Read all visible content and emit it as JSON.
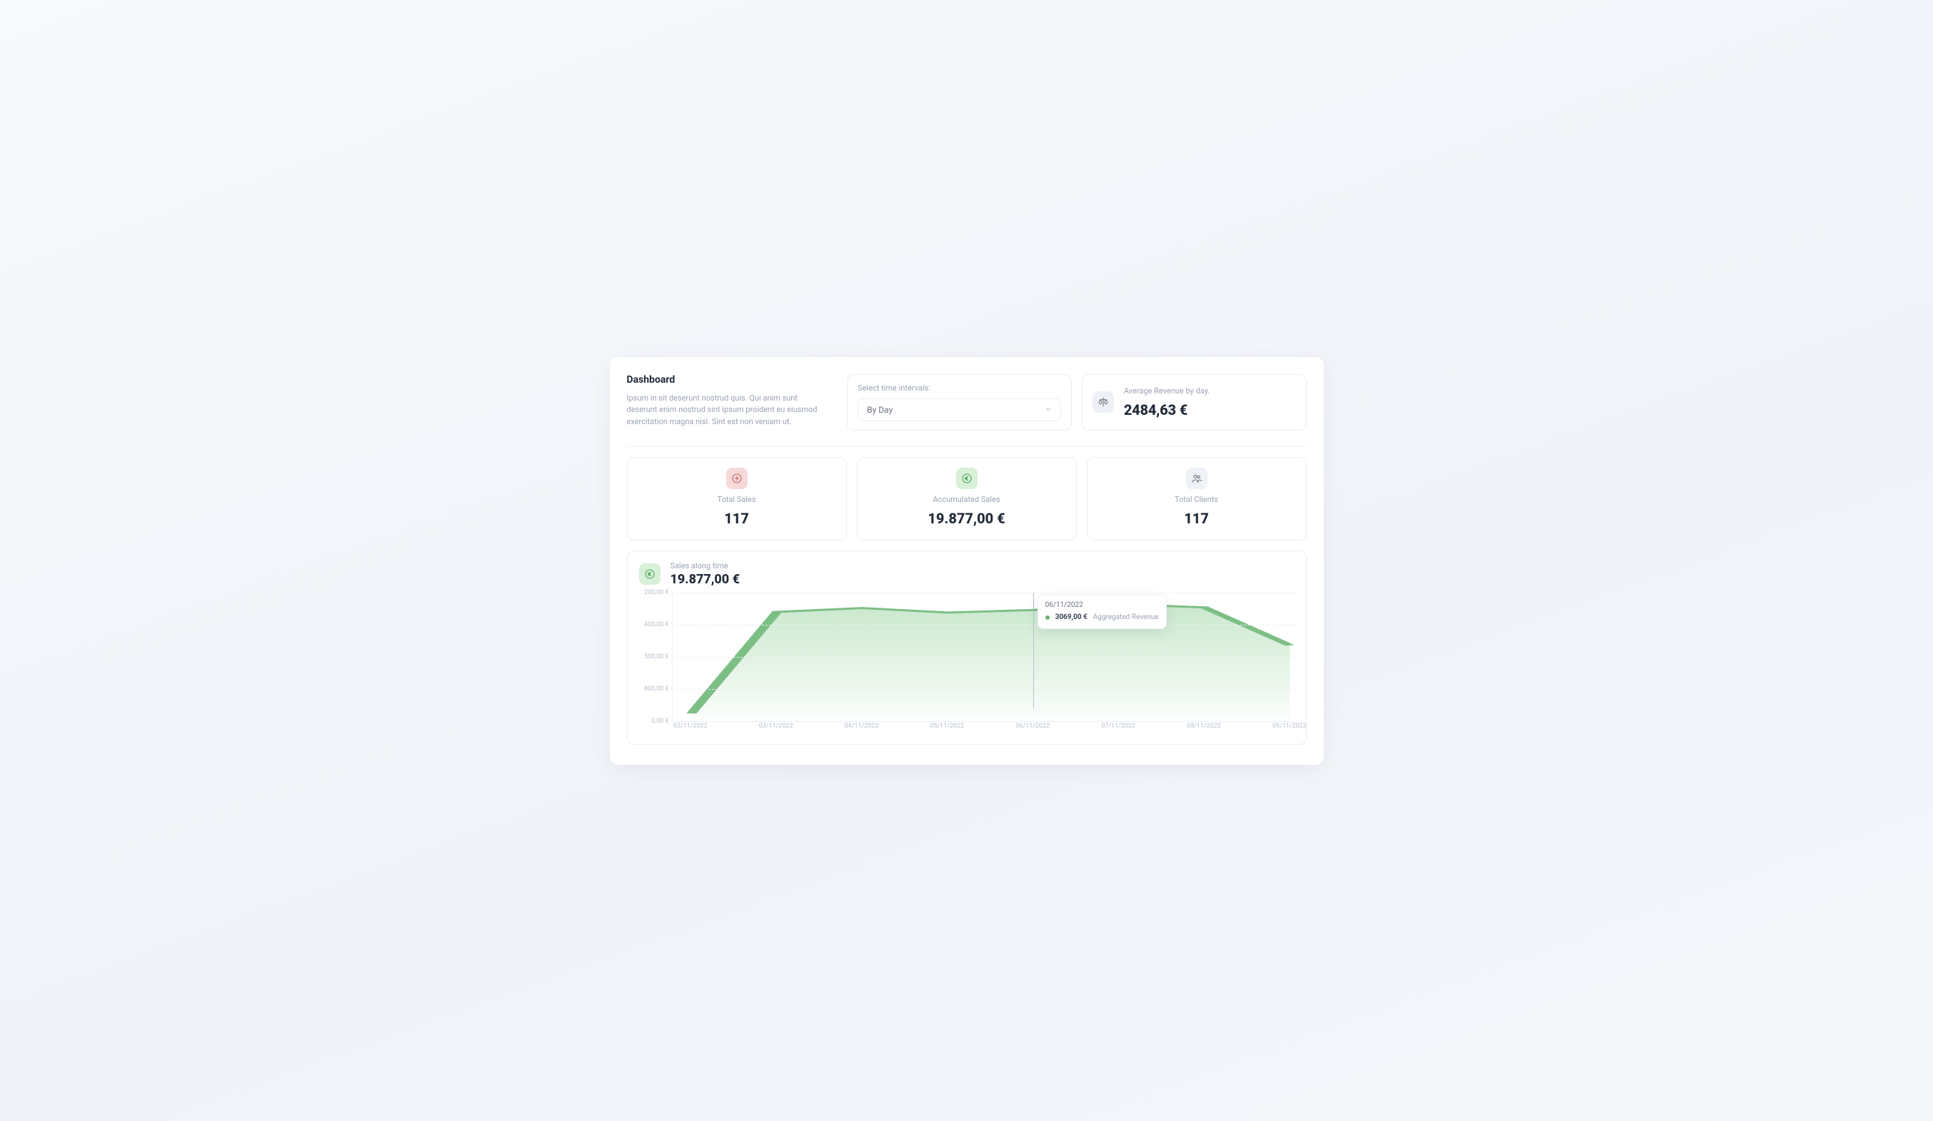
{
  "header": {
    "title": "Dashboard",
    "subtitle": "Ipsum in sit deserunt nostrud quis. Qui anim sunt deserunt enim nostrud sint ipsum proident eu eiusmod exercitation magna nisi. Sint est non veniam ut."
  },
  "interval": {
    "label": "Select time intervals:",
    "selected": "By Day"
  },
  "avg_card": {
    "label": "Average Revenue by day.",
    "value": "2484,63 €"
  },
  "kpis": [
    {
      "icon": "plus-circle",
      "icon_color": "red",
      "label": "Total Sales",
      "value": "117"
    },
    {
      "icon": "euro",
      "icon_color": "green",
      "label": "Accumulated Sales",
      "value": "19.877,00 €"
    },
    {
      "icon": "users",
      "icon_color": "gray",
      "label": "Total Clients",
      "value": "117"
    }
  ],
  "chart": {
    "title": "Sales along time",
    "total": "19.877,00 €",
    "tooltip": {
      "date": "06/11/2022",
      "value": "3069,00 €",
      "series": "Aggregated Revenue"
    }
  },
  "chart_data": {
    "type": "area",
    "title": "Sales along time",
    "xlabel": "",
    "ylabel": "",
    "ylim": [
      0,
      200
    ],
    "y_direction": "inverted_labels",
    "y_ticks_labels": [
      "200,00 €",
      "400,00 €",
      "500,00 €",
      "800,00 €",
      "0,00 €"
    ],
    "x_ticks_labels": [
      "02/11/2022",
      "03/11/2022",
      "04/11/2022",
      "05/11/2022",
      "06/11/2022",
      "07/11/2022",
      "08/11/2022",
      "09/11/2022"
    ],
    "categories": [
      "02/11/2022",
      "03/11/2022",
      "04/11/2022",
      "05/11/2022",
      "06/11/2022",
      "07/11/2022",
      "08/11/2022",
      "09/11/2022"
    ],
    "series": [
      {
        "name": "Aggregated Revenue",
        "color": "#7cbf85",
        "values_estimated": [
          12,
          170,
          176,
          169,
          173,
          182,
          177,
          118
        ],
        "note": "Y-axis tick labels in the screenshot do not increase linearly, so exact values are estimated from vertical position on a 0–200 scale; these are approximate."
      }
    ],
    "annotations": [
      {
        "x": "06/11/2022",
        "label": "3069,00 €",
        "series": "Aggregated Revenue"
      }
    ]
  },
  "colors": {
    "accent_green": "#7cbf85",
    "accent_red_bg": "#f7d9d9",
    "accent_red_fg": "#c05f5f",
    "accent_green_bg": "#d8efd8",
    "accent_green_fg": "#4aa55a",
    "accent_gray_bg": "#eef1f5",
    "accent_gray_fg": "#6b7280"
  }
}
